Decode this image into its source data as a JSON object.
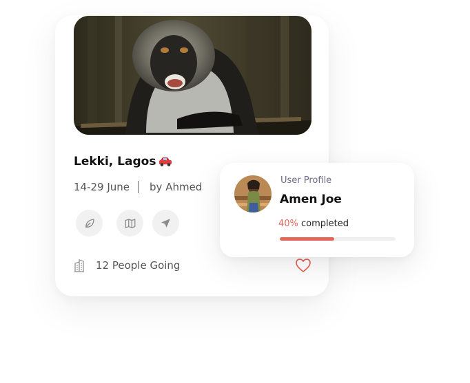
{
  "trip": {
    "location": "Lekki, Lagos",
    "location_emoji_icon": "car-icon",
    "dates": "14-29 June",
    "host": "by Ahmed",
    "actions": [
      {
        "name": "leaf-button",
        "icon": "leaf-icon"
      },
      {
        "name": "map-button",
        "icon": "map-icon"
      },
      {
        "name": "send-button",
        "icon": "send-icon"
      }
    ],
    "people_going": "12 People Going",
    "colors": {
      "heart": "#e4655a"
    }
  },
  "profile": {
    "label": "User Profile",
    "name": "Amen Joe",
    "progress_percent": "40%",
    "progress_suffix": " completed",
    "progress_value": 0.47,
    "colors": {
      "accent": "#e4655a"
    }
  }
}
